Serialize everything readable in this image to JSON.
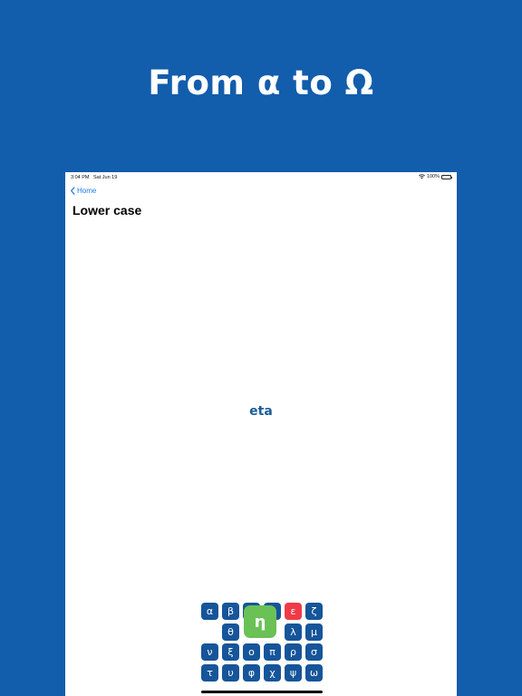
{
  "headline": "From α to Ω",
  "status": {
    "time": "3:04 PM",
    "date": "Sat Jun 19",
    "battery": "100%"
  },
  "nav": {
    "back_label": "Home",
    "title": "Lower case"
  },
  "current": {
    "name": "eta",
    "letter": "η"
  },
  "keys": {
    "alpha": "α",
    "beta": "β",
    "gamma": "γ",
    "delta": "δ",
    "epsilon": "ε",
    "zeta": "ζ",
    "theta": "θ",
    "lambda": "λ",
    "mu": "μ",
    "nu": "ν",
    "xi": "ξ",
    "omicron": "ο",
    "pi": "π",
    "rho": "ρ",
    "sigma": "σ",
    "tau": "τ",
    "upsilon": "υ",
    "phi": "φ",
    "chi": "χ",
    "psi": "ψ",
    "omega": "ω"
  },
  "colors": {
    "background": "#125dac",
    "key": "#16559a",
    "key_wrong": "#ef3b48",
    "key_selected": "#6ac156",
    "link": "#1f7ae6",
    "letter_name": "#1a5d9b"
  }
}
